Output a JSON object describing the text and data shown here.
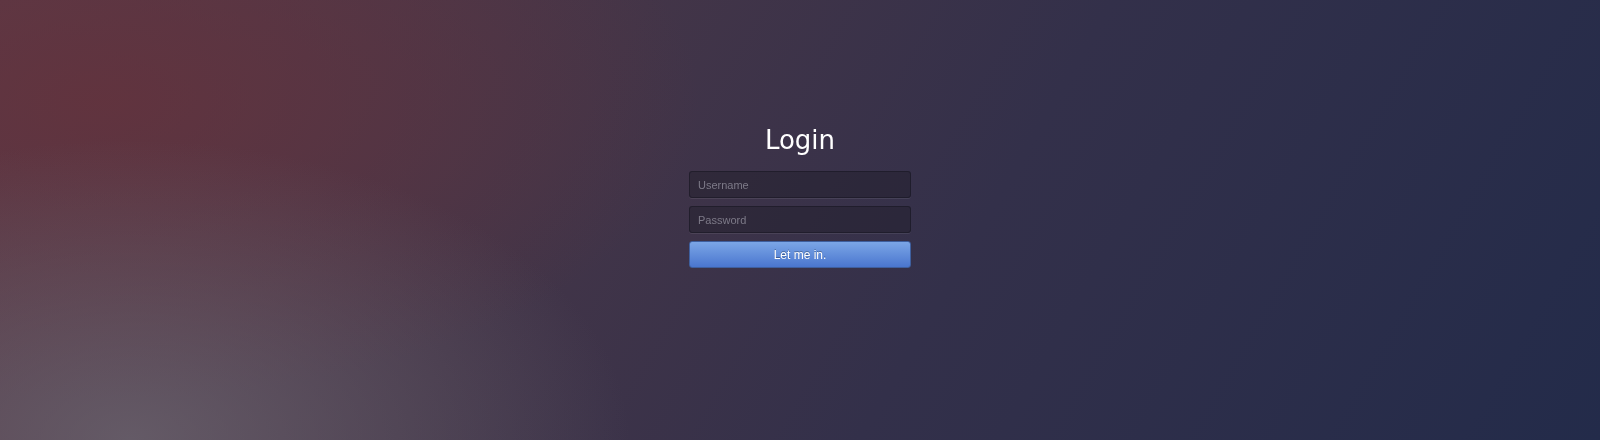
{
  "title": "Login",
  "fields": [
    {
      "placeholder": "Username"
    },
    {
      "placeholder": "Password"
    }
  ],
  "button": "Let me in."
}
